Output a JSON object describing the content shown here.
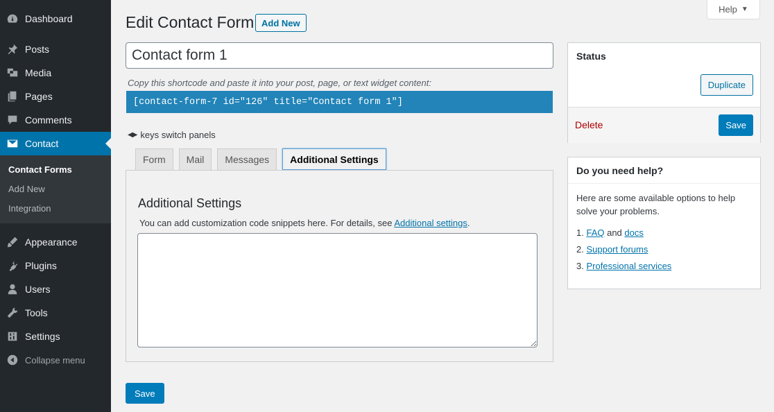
{
  "sidebar": {
    "items": [
      {
        "label": "Dashboard",
        "icon": "dashboard-icon"
      },
      {
        "label": "Posts",
        "icon": "pin-icon"
      },
      {
        "label": "Media",
        "icon": "media-icon"
      },
      {
        "label": "Pages",
        "icon": "pages-icon"
      },
      {
        "label": "Comments",
        "icon": "comment-icon"
      },
      {
        "label": "Contact",
        "icon": "envelope-icon",
        "active": true
      },
      {
        "label": "Appearance",
        "icon": "brush-icon"
      },
      {
        "label": "Plugins",
        "icon": "plugin-icon"
      },
      {
        "label": "Users",
        "icon": "user-icon"
      },
      {
        "label": "Tools",
        "icon": "wrench-icon"
      },
      {
        "label": "Settings",
        "icon": "settings-icon"
      }
    ],
    "submenu": [
      "Contact Forms",
      "Add New",
      "Integration"
    ],
    "collapse_label": "Collapse menu"
  },
  "header": {
    "help_label": "Help",
    "page_title": "Edit Contact Form",
    "add_new_label": "Add New"
  },
  "form": {
    "title_value": "Contact form 1",
    "shortcode_label": "Copy this shortcode and paste it into your post, page, or text widget content:",
    "shortcode": "[contact-form-7 id=\"126\" title=\"Contact form 1\"]",
    "keys_hint": "keys switch panels",
    "tabs": [
      "Form",
      "Mail",
      "Messages",
      "Additional Settings"
    ],
    "active_tab": "Additional Settings",
    "panel": {
      "heading": "Additional Settings",
      "desc_prefix": "You can add customization code snippets here. For details, see ",
      "desc_link": "Additional settings",
      "desc_suffix": ".",
      "textarea_value": ""
    },
    "save_label": "Save"
  },
  "status_box": {
    "heading": "Status",
    "duplicate_label": "Duplicate",
    "delete_label": "Delete",
    "save_label": "Save"
  },
  "help_box": {
    "heading": "Do you need help?",
    "text": "Here are some available options to help solve your problems.",
    "items": [
      {
        "num": "1.",
        "link1": "FAQ",
        "mid": " and ",
        "link2": "docs"
      },
      {
        "num": "2.",
        "link1": "Support forums"
      },
      {
        "num": "3.",
        "link1": "Professional services"
      }
    ]
  },
  "colors": {
    "sidebar_bg": "#23282d",
    "accent": "#0073aa",
    "shortcode_bg": "#2284b8",
    "delete": "#aa0000"
  }
}
